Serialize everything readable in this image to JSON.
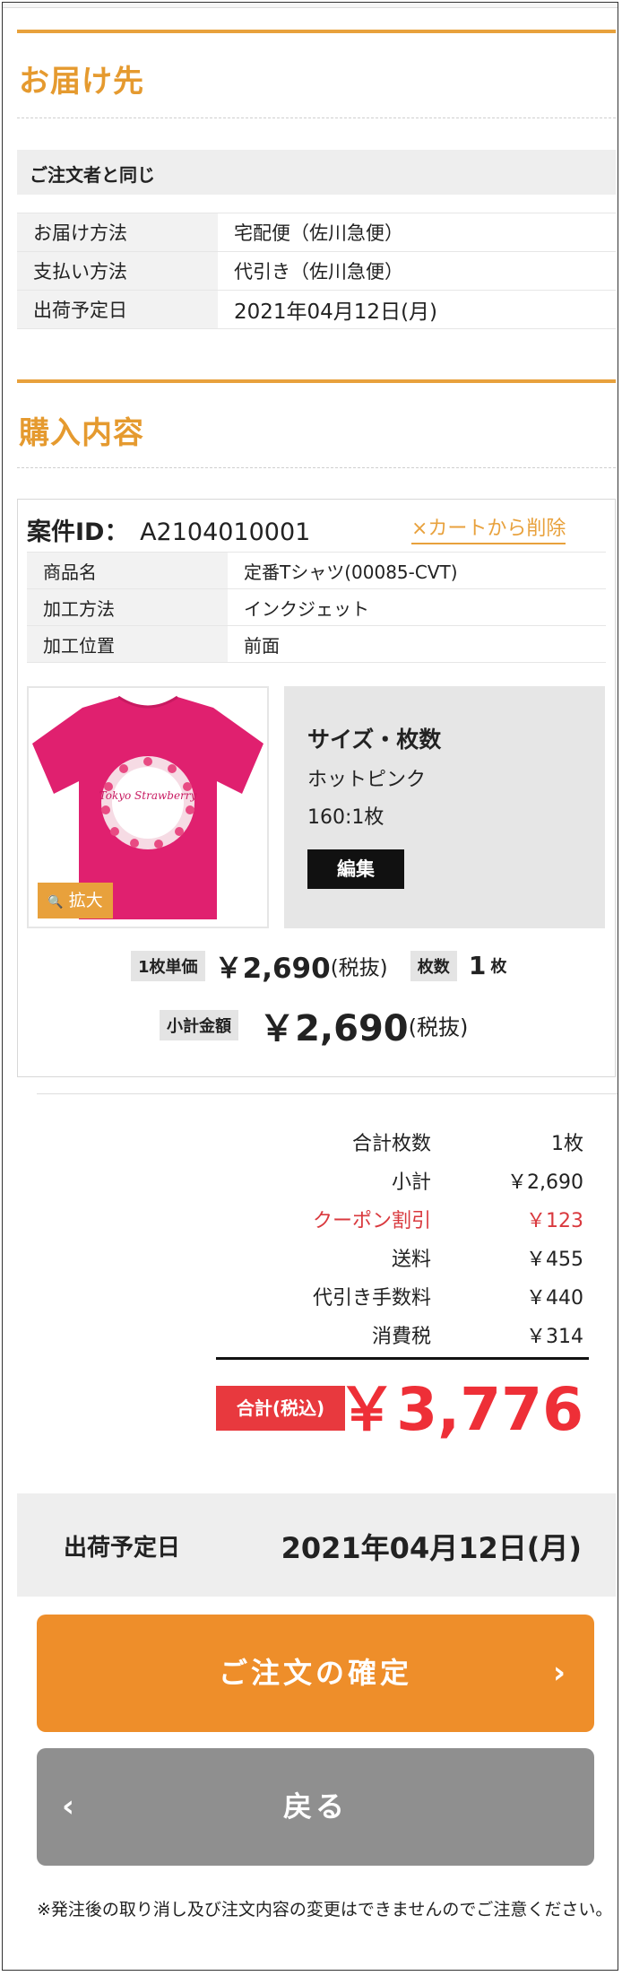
{
  "delivery": {
    "title": "お届け先",
    "recipient": "ご注文者と同じ",
    "rows": [
      {
        "label": "お届け方法",
        "value": "宅配便（佐川急便）"
      },
      {
        "label": "支払い方法",
        "value": "代引き（佐川急便）"
      },
      {
        "label": "出荷予定日",
        "value": "2021年04月12日(月)"
      }
    ]
  },
  "purchase": {
    "title": "購入内容",
    "case_label": "案件ID：",
    "case_id": "A2104010001",
    "remove_label": "×カートから削除",
    "rows": [
      {
        "label": "商品名",
        "value": "定番Tシャツ(00085-CVT)"
      },
      {
        "label": "加工方法",
        "value": "インクジェット"
      },
      {
        "label": "加工位置",
        "value": "前面"
      }
    ],
    "zoom_label": "拡大",
    "shirt_text": "Tokyo Strawberry",
    "size_title": "サイズ・枚数",
    "color": "ホットピンク",
    "size_qty": "160:1枚",
    "edit_label": "編集",
    "unit_price_label": "1枚単価",
    "unit_price": "￥2,690",
    "tax_ex": "(税抜)",
    "qty_label": "枚数",
    "qty": "1",
    "qty_unit": "枚",
    "subtotal_label": "小計金額",
    "subtotal": "￥2,690",
    "colors": {
      "accent": "#e8a13c",
      "shirt": "#e0206f"
    }
  },
  "summary": {
    "rows": [
      {
        "label": "合計枚数",
        "value": "1枚"
      },
      {
        "label": "小計",
        "value": "￥2,690"
      },
      {
        "label": "クーポン割引",
        "value": "￥123"
      },
      {
        "label": "送料",
        "value": "￥455"
      },
      {
        "label": "代引き手数料",
        "value": "￥440"
      },
      {
        "label": "消費税",
        "value": "￥314"
      }
    ],
    "total_label": "合計(税込)",
    "total": "￥3,776",
    "colors": {
      "discount": "#d9393e",
      "total": "#ee2f37"
    }
  },
  "shipping": {
    "label": "出荷予定日",
    "date": "2021年04月12日(月)"
  },
  "buttons": {
    "confirm": "ご注文の確定",
    "back": "戻る",
    "confirm_icon": "chevron-right-icon",
    "back_icon": "chevron-left-icon",
    "colors": {
      "confirm": "#ee8e2a",
      "back": "#8f8f8f"
    }
  },
  "notice": "※発注後の取り消し及び注文内容の変更はできませんのでご注意ください。"
}
